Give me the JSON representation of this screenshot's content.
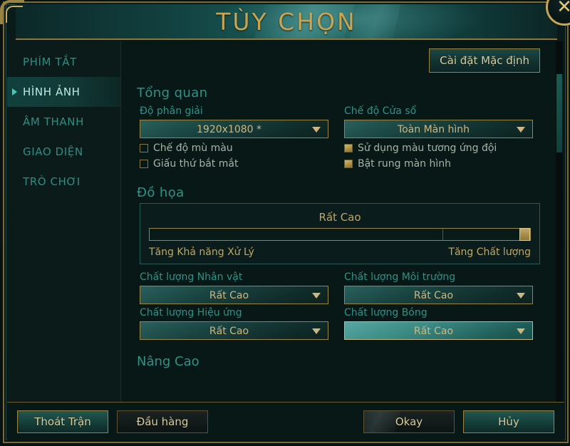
{
  "window": {
    "title": "TÙY CHỌN",
    "close_icon": "close-icon"
  },
  "sidebar": {
    "items": [
      {
        "label": "PHÍM TẮT",
        "active": false
      },
      {
        "label": "HÌNH ẢNH",
        "active": true
      },
      {
        "label": "ÂM THANH",
        "active": false
      },
      {
        "label": "GIAO DIỆN",
        "active": false
      },
      {
        "label": "TRÒ CHƠI",
        "active": false
      }
    ]
  },
  "content": {
    "defaults_button": "Cài đặt Mặc định",
    "overview": {
      "title": "Tổng quan",
      "resolution_label": "Độ phân giải",
      "resolution_value": "1920x1080 *",
      "window_mode_label": "Chế độ Cửa sổ",
      "window_mode_value": "Toàn Màn hình",
      "checkboxes": [
        {
          "label": "Chế độ mù màu",
          "checked": false
        },
        {
          "label": "Giấu thứ bắt mắt",
          "checked": false
        },
        {
          "label": "Sử dụng màu tương ứng đội",
          "checked": true
        },
        {
          "label": "Bật rung màn hình",
          "checked": true
        }
      ]
    },
    "graphics": {
      "title": "Đồ họa",
      "preset_value": "Rất Cao",
      "slider_percent": 100,
      "tick_percent": 77,
      "left_label": "Tăng Khả năng Xử Lý",
      "right_label": "Tăng Chất lượng",
      "quality_dropdowns": [
        {
          "label": "Chất lượng Nhân vật",
          "value": "Rất Cao",
          "highlighted": false
        },
        {
          "label": "Chất lượng Môi trường",
          "value": "Rất Cao",
          "highlighted": false
        },
        {
          "label": "Chất lượng Hiệu ứng",
          "value": "Rất Cao",
          "highlighted": false
        },
        {
          "label": "Chất lượng Bóng",
          "value": "Rất Cao",
          "highlighted": true
        }
      ]
    },
    "advanced": {
      "title": "Nâng Cao"
    }
  },
  "footer": {
    "exit_match": "Thoát Trận",
    "surrender": "Đầu hàng",
    "okay": "Okay",
    "cancel": "Hủy"
  },
  "colors": {
    "gold": "#c8a552",
    "teal": "#2f9285",
    "accent_light": "#b9ece3"
  }
}
